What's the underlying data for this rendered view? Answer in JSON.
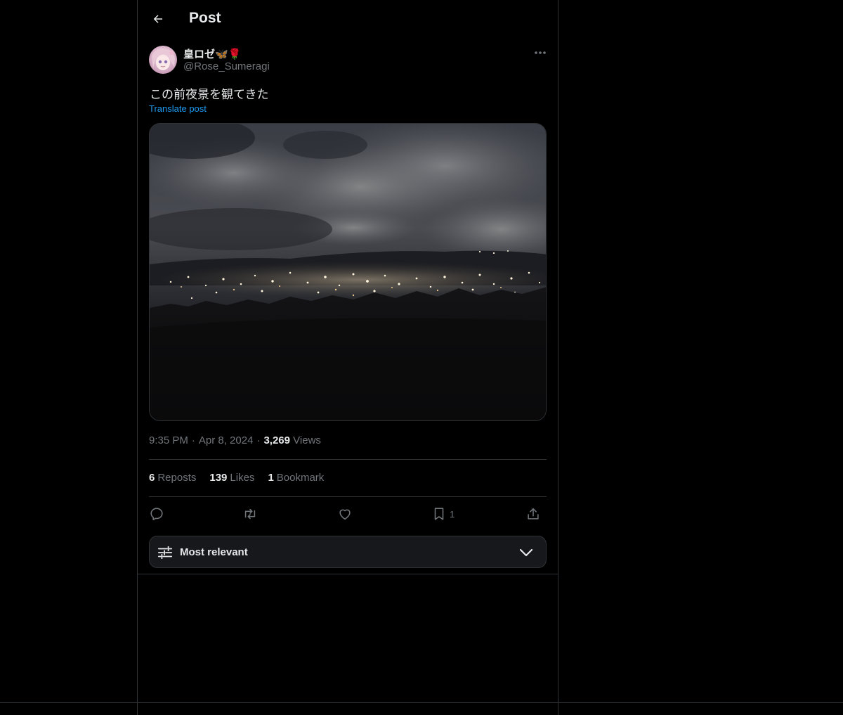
{
  "header": {
    "title": "Post",
    "back_icon": "arrow-left-icon"
  },
  "author": {
    "display_name": "皇ロゼ🦋🌹",
    "handle": "@Rose_Sumeragi"
  },
  "post": {
    "text": "この前夜景を観てきた",
    "translate_label": "Translate post",
    "time": "9:35 PM",
    "date": "Apr 8, 2024",
    "views_count": "3,269",
    "views_label": "Views"
  },
  "stats": {
    "reposts_count": "6",
    "reposts_label": "Reposts",
    "likes_count": "139",
    "likes_label": "Likes",
    "bookmarks_count": "1",
    "bookmarks_label": "Bookmark"
  },
  "actions": {
    "bookmark_count": "1",
    "icons": [
      "reply-icon",
      "repost-icon",
      "like-icon",
      "bookmark-icon",
      "share-icon"
    ]
  },
  "sort": {
    "label": "Most relevant"
  },
  "colors": {
    "background": "#000000",
    "border": "#2f3336",
    "text_primary": "#e7e9ea",
    "text_secondary": "#71767b",
    "link": "#1d9bf0",
    "sort_bar_bg": "#16181c"
  }
}
